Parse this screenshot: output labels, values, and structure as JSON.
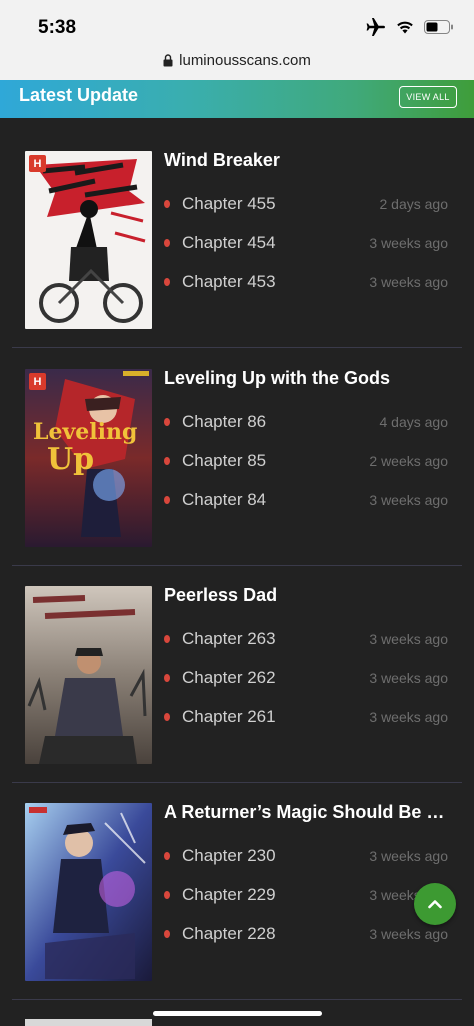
{
  "status": {
    "time": "5:38"
  },
  "browser": {
    "url": "luminousscans.com"
  },
  "header": {
    "title": "Latest Update",
    "view_all": "VIEW ALL"
  },
  "series": [
    {
      "title": "Wind Breaker",
      "badge": "H",
      "chapters": [
        {
          "label": "Chapter 455",
          "time": "2 days ago"
        },
        {
          "label": "Chapter 454",
          "time": "3 weeks ago"
        },
        {
          "label": "Chapter 453",
          "time": "3 weeks ago"
        }
      ]
    },
    {
      "title": "Leveling Up with the Gods",
      "badge": "H",
      "chapters": [
        {
          "label": "Chapter 86",
          "time": "4 days ago"
        },
        {
          "label": "Chapter 85",
          "time": "2 weeks ago"
        },
        {
          "label": "Chapter 84",
          "time": "3 weeks ago"
        }
      ]
    },
    {
      "title": "Peerless Dad",
      "chapters": [
        {
          "label": "Chapter 263",
          "time": "3 weeks ago"
        },
        {
          "label": "Chapter 262",
          "time": "3 weeks ago"
        },
        {
          "label": "Chapter 261",
          "time": "3 weeks ago"
        }
      ]
    },
    {
      "title": "A Returner’s Magic Should Be Special",
      "chapters": [
        {
          "label": "Chapter 230",
          "time": "3 weeks ago"
        },
        {
          "label": "Chapter 229",
          "time": "3 weeks ago"
        },
        {
          "label": "Chapter 228",
          "time": "3 weeks ago"
        }
      ]
    }
  ],
  "colors": {
    "background": "#222222",
    "accent_green": "#3d9a32",
    "bullet": "#d9473c",
    "badge": "#d93a2b"
  }
}
